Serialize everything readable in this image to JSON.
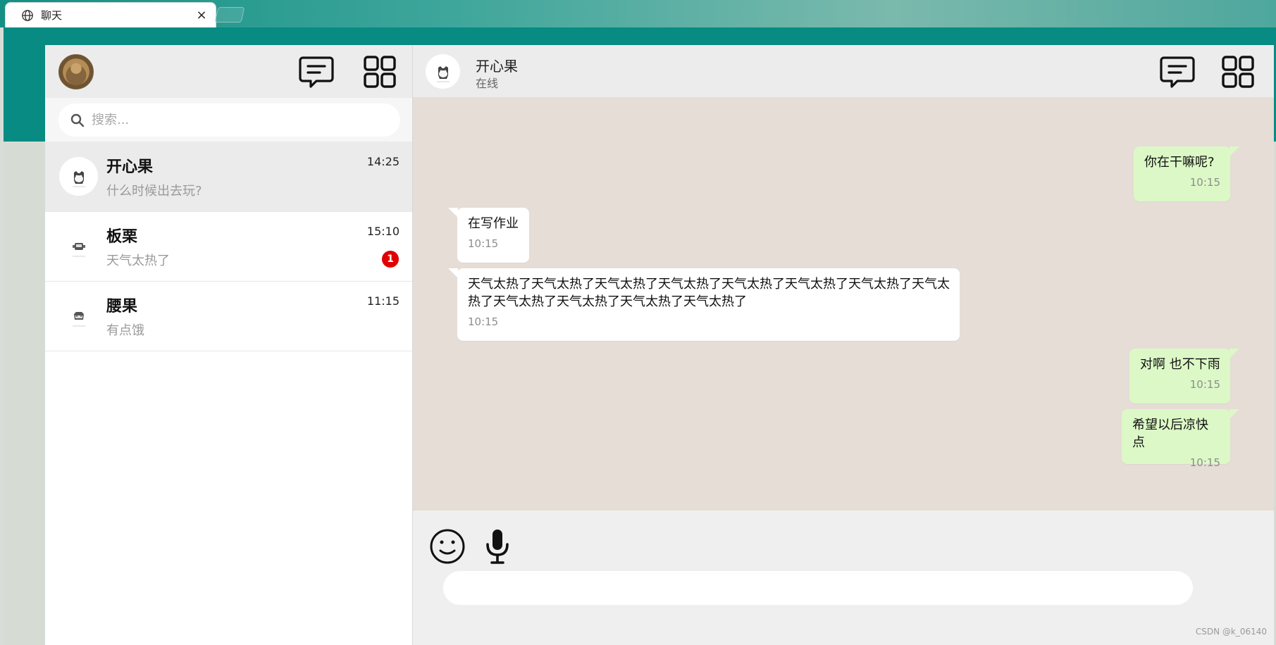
{
  "browser": {
    "tab_title": "聊天",
    "close_glyph": "×",
    "accent": "#078b82"
  },
  "sidebar": {
    "search_placeholder": "搜索...",
    "chats": [
      {
        "name": "开心果",
        "preview": "什么时候出去玩?",
        "time": "14:25",
        "badge": ""
      },
      {
        "name": "板栗",
        "preview": "天气太热了",
        "time": "15:10",
        "badge": "1"
      },
      {
        "name": "腰果",
        "preview": "有点饿",
        "time": "11:15",
        "badge": ""
      }
    ]
  },
  "conversation": {
    "name": "开心果",
    "status": "在线",
    "messages": [
      {
        "text": "你在干嘛呢?",
        "time": "10:15",
        "side": "right"
      },
      {
        "text": "在写作业",
        "time": "10:15",
        "side": "left"
      },
      {
        "text": "天气太热了天气太热了天气太热了天气太热了天气太热了天气太热了天气太热了天气太热了天气太热了天气太热了天气太热了天气太热了",
        "time": "10:15",
        "side": "left"
      },
      {
        "text": "对啊 也不下雨",
        "time": "10:15",
        "side": "right"
      },
      {
        "text": "希望以后凉快点",
        "time": "10:15",
        "side": "right"
      }
    ]
  },
  "footer": {
    "watermark": "CSDN @k_06140"
  },
  "icons": {
    "globe": "globe-icon",
    "chat": "message-icon",
    "grid": "grid-icon",
    "search": "search-icon",
    "emoji": "smile-icon",
    "mic": "microphone-icon"
  }
}
